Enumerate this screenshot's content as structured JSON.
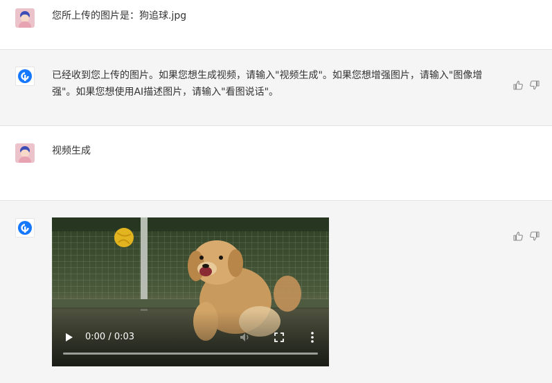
{
  "messages": [
    {
      "role": "user",
      "text": "您所上传的图片是：狗追球.jpg"
    },
    {
      "role": "assistant",
      "text": "已经收到您上传的图片。如果您想生成视频，请输入\"视频生成\"。如果您想增强图片，请输入\"图像增强\"。如果您想使用AI描述图片，请输入\"看图说话\"。"
    },
    {
      "role": "user",
      "text": "视频生成"
    },
    {
      "role": "assistant",
      "video": {
        "time_display": "0:00 / 0:03",
        "progress": 0
      }
    }
  ],
  "icons": {
    "user_avatar": "user-avatar-icon",
    "bot_avatar": "bot-logo-icon",
    "like": "thumbs-up-icon",
    "dislike": "thumbs-down-icon",
    "play": "play-icon",
    "volume": "volume-icon",
    "fullscreen": "fullscreen-icon",
    "menu": "more-vertical-icon"
  },
  "colors": {
    "bot_row_bg": "#f5f5f5",
    "bot_logo": "#1677ff",
    "text": "#333333"
  }
}
